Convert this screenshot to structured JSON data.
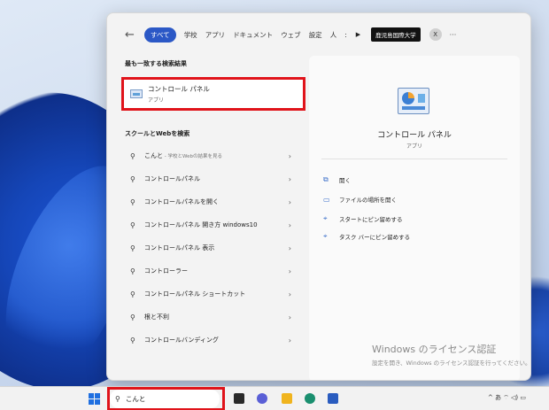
{
  "filters": {
    "back": "←",
    "items": [
      "すべて",
      "学校",
      "アプリ",
      "ドキュメント",
      "ウェブ",
      "設定",
      "人",
      ":"
    ],
    "more_arrow": "▶",
    "org_badge": "鹿児島国際大学",
    "avatar": "X",
    "overflow": "···"
  },
  "best_match": {
    "header": "最も一致する検索結果",
    "title": "コントロール パネル",
    "subtitle": "アプリ"
  },
  "web_search": {
    "header": "スクールとWebを検索",
    "items": [
      {
        "text": "こんと",
        "sub": " - 学校とWebの結果を見る"
      },
      {
        "text": "コントロールパネル",
        "sub": ""
      },
      {
        "text": "コントロールパネルを開く",
        "sub": ""
      },
      {
        "text": "コントロールパネル 開き方 windows10",
        "sub": ""
      },
      {
        "text": "コントロールパネル 表示",
        "sub": ""
      },
      {
        "text": "コントローラー",
        "sub": ""
      },
      {
        "text": "コントロールパネル ショートカット",
        "sub": ""
      },
      {
        "text": "根と不利",
        "sub": ""
      },
      {
        "text": "コントロールバンディング",
        "sub": ""
      }
    ]
  },
  "preview": {
    "title": "コントロール パネル",
    "subtitle": "アプリ",
    "actions": [
      {
        "icon": "open-icon",
        "label": "開く"
      },
      {
        "icon": "folder-icon",
        "label": "ファイルの場所を開く"
      },
      {
        "icon": "pin-icon",
        "label": "スタートにピン留めする"
      },
      {
        "icon": "pin-icon",
        "label": "タスク バーにピン留めする"
      }
    ]
  },
  "watermark": {
    "line1": "Windows のライセンス認証",
    "line2": "設定を開き、Windows のライセンス認証を行ってください。"
  },
  "taskbar": {
    "search_value": "こんと",
    "tray": "^  あ  ⌔  ◁)  ▭"
  },
  "colors": {
    "accent": "#2b58c6",
    "highlight": "#e0131a"
  }
}
